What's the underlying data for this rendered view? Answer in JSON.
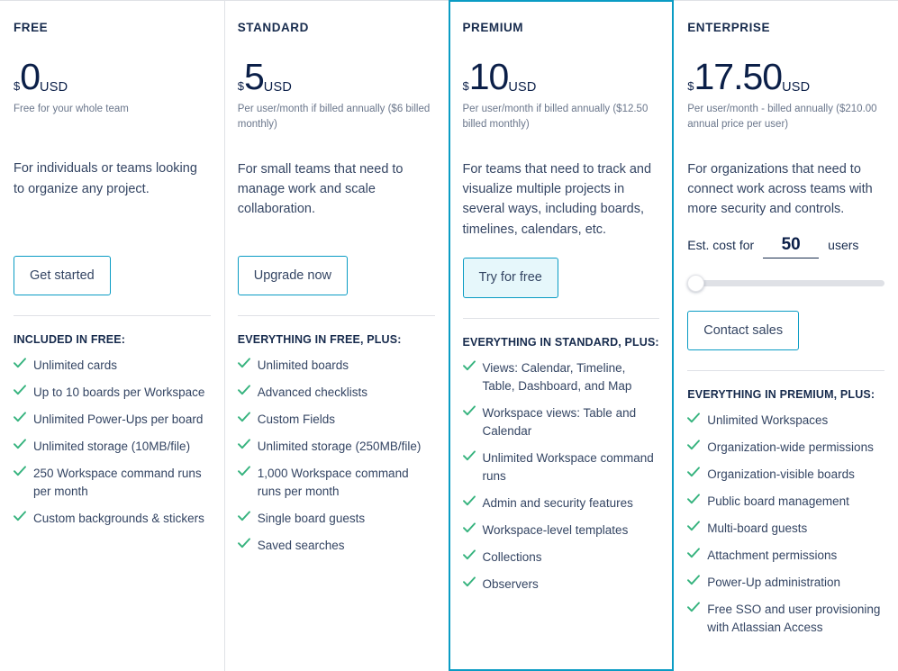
{
  "theme": {
    "accent": "#0a9cc4",
    "accent_fill": "#e6f7fb",
    "text_dark": "#172b4d",
    "text_body": "#344563",
    "text_muted": "#6b778c",
    "price_color": "#0b1f48",
    "check_green": "#36b37e",
    "divider": "#dfe1e6",
    "slider_track": "#dfe1e6"
  },
  "plans": [
    {
      "id": "free",
      "name": "FREE",
      "featured": false,
      "price": {
        "currency_symbol": "$",
        "amount": "0",
        "currency_code": "USD"
      },
      "price_note": "Free for your whole team",
      "description": "For individuals or teams looking to organize any project.",
      "cta": {
        "label": "Get started",
        "style": "outline"
      },
      "features_title": "INCLUDED IN FREE:",
      "features": [
        "Unlimited cards",
        "Up to 10 boards per Workspace",
        "Unlimited Power-Ups per board",
        "Unlimited storage (10MB/file)",
        "250 Workspace command runs per month",
        "Custom backgrounds & stickers"
      ]
    },
    {
      "id": "standard",
      "name": "STANDARD",
      "featured": false,
      "price": {
        "currency_symbol": "$",
        "amount": "5",
        "currency_code": "USD"
      },
      "price_note": "Per user/month if billed annually ($6 billed monthly)",
      "description": "For small teams that need to manage work and scale collaboration.",
      "cta": {
        "label": "Upgrade now",
        "style": "outline"
      },
      "features_title": "EVERYTHING IN FREE, PLUS:",
      "features": [
        "Unlimited boards",
        "Advanced checklists",
        "Custom Fields",
        "Unlimited storage (250MB/file)",
        "1,000 Workspace command runs per month",
        "Single board guests",
        "Saved searches"
      ]
    },
    {
      "id": "premium",
      "name": "PREMIUM",
      "featured": true,
      "price": {
        "currency_symbol": "$",
        "amount": "10",
        "currency_code": "USD"
      },
      "price_note": "Per user/month if billed annually ($12.50 billed monthly)",
      "description": "For teams that need to track and visualize multiple projects in several ways, including boards, timelines, calendars, etc.",
      "cta": {
        "label": "Try for free",
        "style": "filled"
      },
      "features_title": "EVERYTHING IN STANDARD, PLUS:",
      "features": [
        "Views: Calendar, Timeline, Table, Dashboard, and Map",
        "Workspace views: Table and Calendar",
        "Unlimited Workspace command runs",
        "Admin and security features",
        "Workspace-level templates",
        "Collections",
        "Observers"
      ]
    },
    {
      "id": "enterprise",
      "name": "ENTERPRISE",
      "featured": false,
      "price": {
        "currency_symbol": "$",
        "amount": "17.50",
        "currency_code": "USD"
      },
      "price_note": "Per user/month - billed annually ($210.00 annual price per user)",
      "description": "For organizations that need to connect work across teams with more security and controls.",
      "estimator": {
        "label_prefix": "Est. cost for",
        "value": "50",
        "label_suffix": "users",
        "slider_position_percent": 0
      },
      "cta": {
        "label": "Contact sales",
        "style": "outline"
      },
      "features_title": "EVERYTHING IN PREMIUM, PLUS:",
      "features": [
        "Unlimited Workspaces",
        "Organization-wide permissions",
        "Organization-visible boards",
        "Public board management",
        "Multi-board guests",
        "Attachment permissions",
        "Power-Up administration",
        "Free SSO and user provisioning with Atlassian Access"
      ]
    }
  ]
}
